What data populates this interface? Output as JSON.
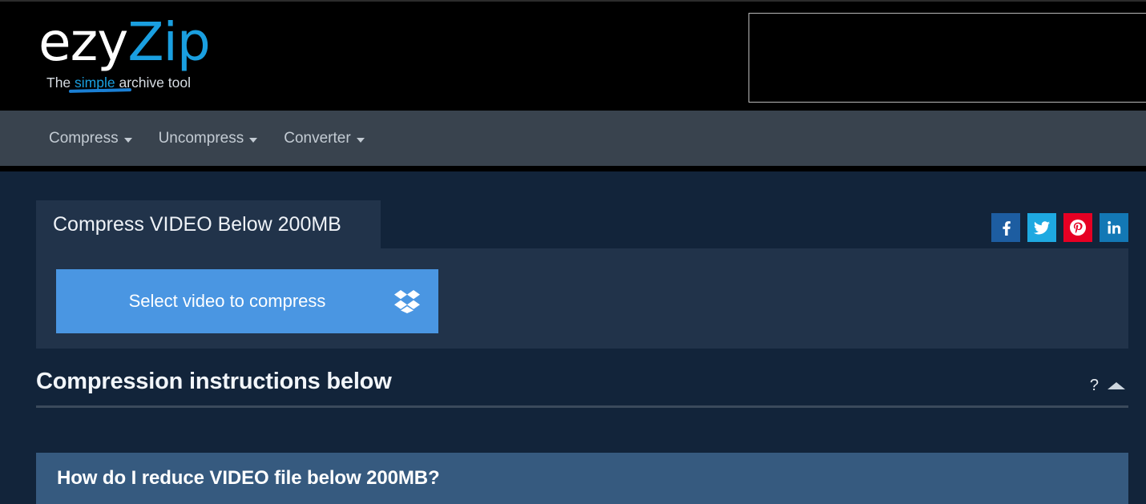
{
  "brand": {
    "logo_primary": "ezy",
    "logo_accent": "Zip",
    "tagline_prefix": "The ",
    "tagline_accent": "simple",
    "tagline_suffix": " archive tool",
    "accent_color": "#1a9fe0"
  },
  "ad": {
    "label": ""
  },
  "nav": {
    "items": [
      {
        "label": "Compress",
        "has_dropdown": true
      },
      {
        "label": "Uncompress",
        "has_dropdown": true
      },
      {
        "label": "Converter",
        "has_dropdown": true
      }
    ]
  },
  "card": {
    "tab_label": "Compress VIDEO Below 200MB",
    "select_button_label": "Select video to compress",
    "select_button_icon": "dropbox-icon",
    "select_button_color": "#4a96e2",
    "body_color": "#21334a"
  },
  "social": {
    "buttons": [
      {
        "name": "facebook",
        "label": "Facebook",
        "color": "#1d5da1",
        "glyph": "f"
      },
      {
        "name": "twitter",
        "label": "Twitter",
        "color": "#1ea9e1",
        "glyph": "bird"
      },
      {
        "name": "pinterest",
        "label": "Pinterest",
        "color": "#e60023",
        "glyph": "p"
      },
      {
        "name": "linkedin",
        "label": "LinkedIn",
        "color": "#1378b5",
        "glyph": "in"
      }
    ]
  },
  "instructions": {
    "title": "Compression instructions below",
    "help_glyph": "?",
    "collapse_icon": "caret-up-icon"
  },
  "faq": {
    "question": "How do I reduce VIDEO file below 200MB?",
    "panel_color": "#365a7f"
  },
  "page": {
    "background_color": "#12243a",
    "navbar_color": "#39434e",
    "header_color": "#000000"
  }
}
